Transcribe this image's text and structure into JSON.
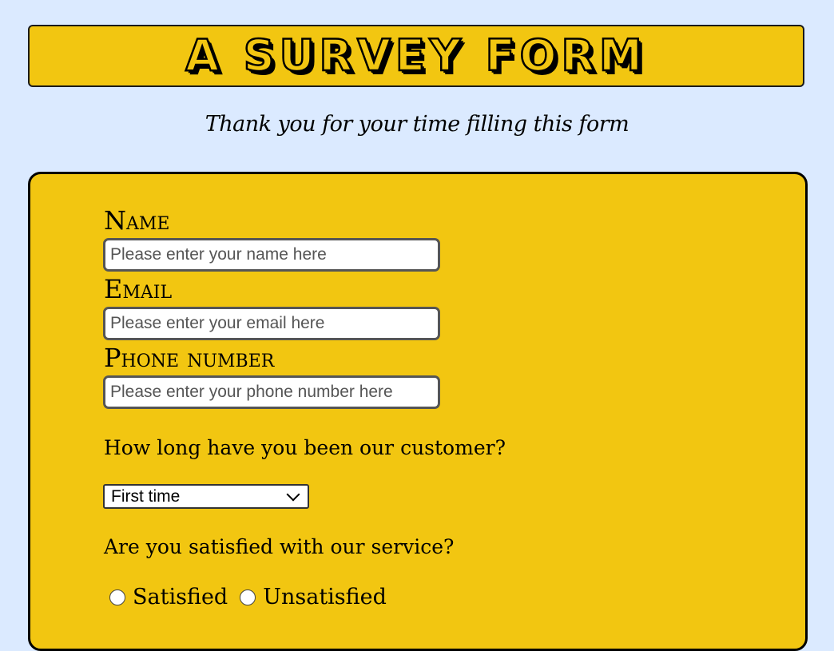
{
  "header": {
    "title": "A Survey Form"
  },
  "subtitle": "Thank you for your time filling this form",
  "form": {
    "name": {
      "label": "Name",
      "placeholder": "Please enter your name here"
    },
    "email": {
      "label": "Email",
      "placeholder": "Please enter your email here"
    },
    "phone": {
      "label": "Phone number",
      "placeholder": "Please enter your phone number here"
    },
    "customer_question": "How long have you been our customer?",
    "customer_select": {
      "selected": "First time"
    },
    "satisfaction_question": "Are you satisfied with our service?",
    "satisfaction_options": [
      "Satisfied",
      "Unsatisfied"
    ]
  },
  "colors": {
    "page_background": "#dbeaff",
    "panel_background": "#f2c611",
    "border": "#000000"
  },
  "icons": {
    "select_arrow": "chevron-down-icon"
  }
}
